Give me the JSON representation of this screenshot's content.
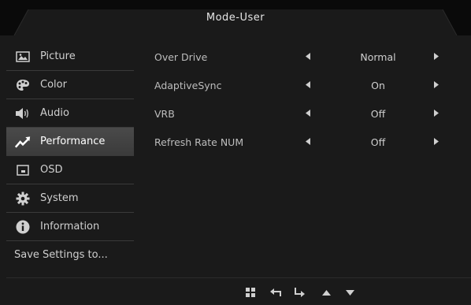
{
  "header": {
    "title": "Mode-User"
  },
  "sidebar": {
    "items": [
      {
        "label": "Picture",
        "icon": "picture-icon"
      },
      {
        "label": "Color",
        "icon": "palette-icon"
      },
      {
        "label": "Audio",
        "icon": "speaker-icon"
      },
      {
        "label": "Performance",
        "icon": "trend-icon",
        "active": true
      },
      {
        "label": "OSD",
        "icon": "osd-icon"
      },
      {
        "label": "System",
        "icon": "gear-icon"
      },
      {
        "label": "Information",
        "icon": "info-icon"
      }
    ],
    "save_label": "Save Settings to..."
  },
  "settings": [
    {
      "label": "Over Drive",
      "value": "Normal"
    },
    {
      "label": "AdaptiveSync",
      "value": "On"
    },
    {
      "label": "VRB",
      "value": "Off"
    },
    {
      "label": "Refresh Rate NUM",
      "value": "Off"
    }
  ],
  "footer": {
    "buttons": [
      "menu-grid-icon",
      "back-icon",
      "enter-icon",
      "up-arrow-icon",
      "down-arrow-icon"
    ]
  },
  "colors": {
    "background": "#1a1a1a",
    "active_bg": "#444444",
    "text": "#cfcfcf"
  }
}
